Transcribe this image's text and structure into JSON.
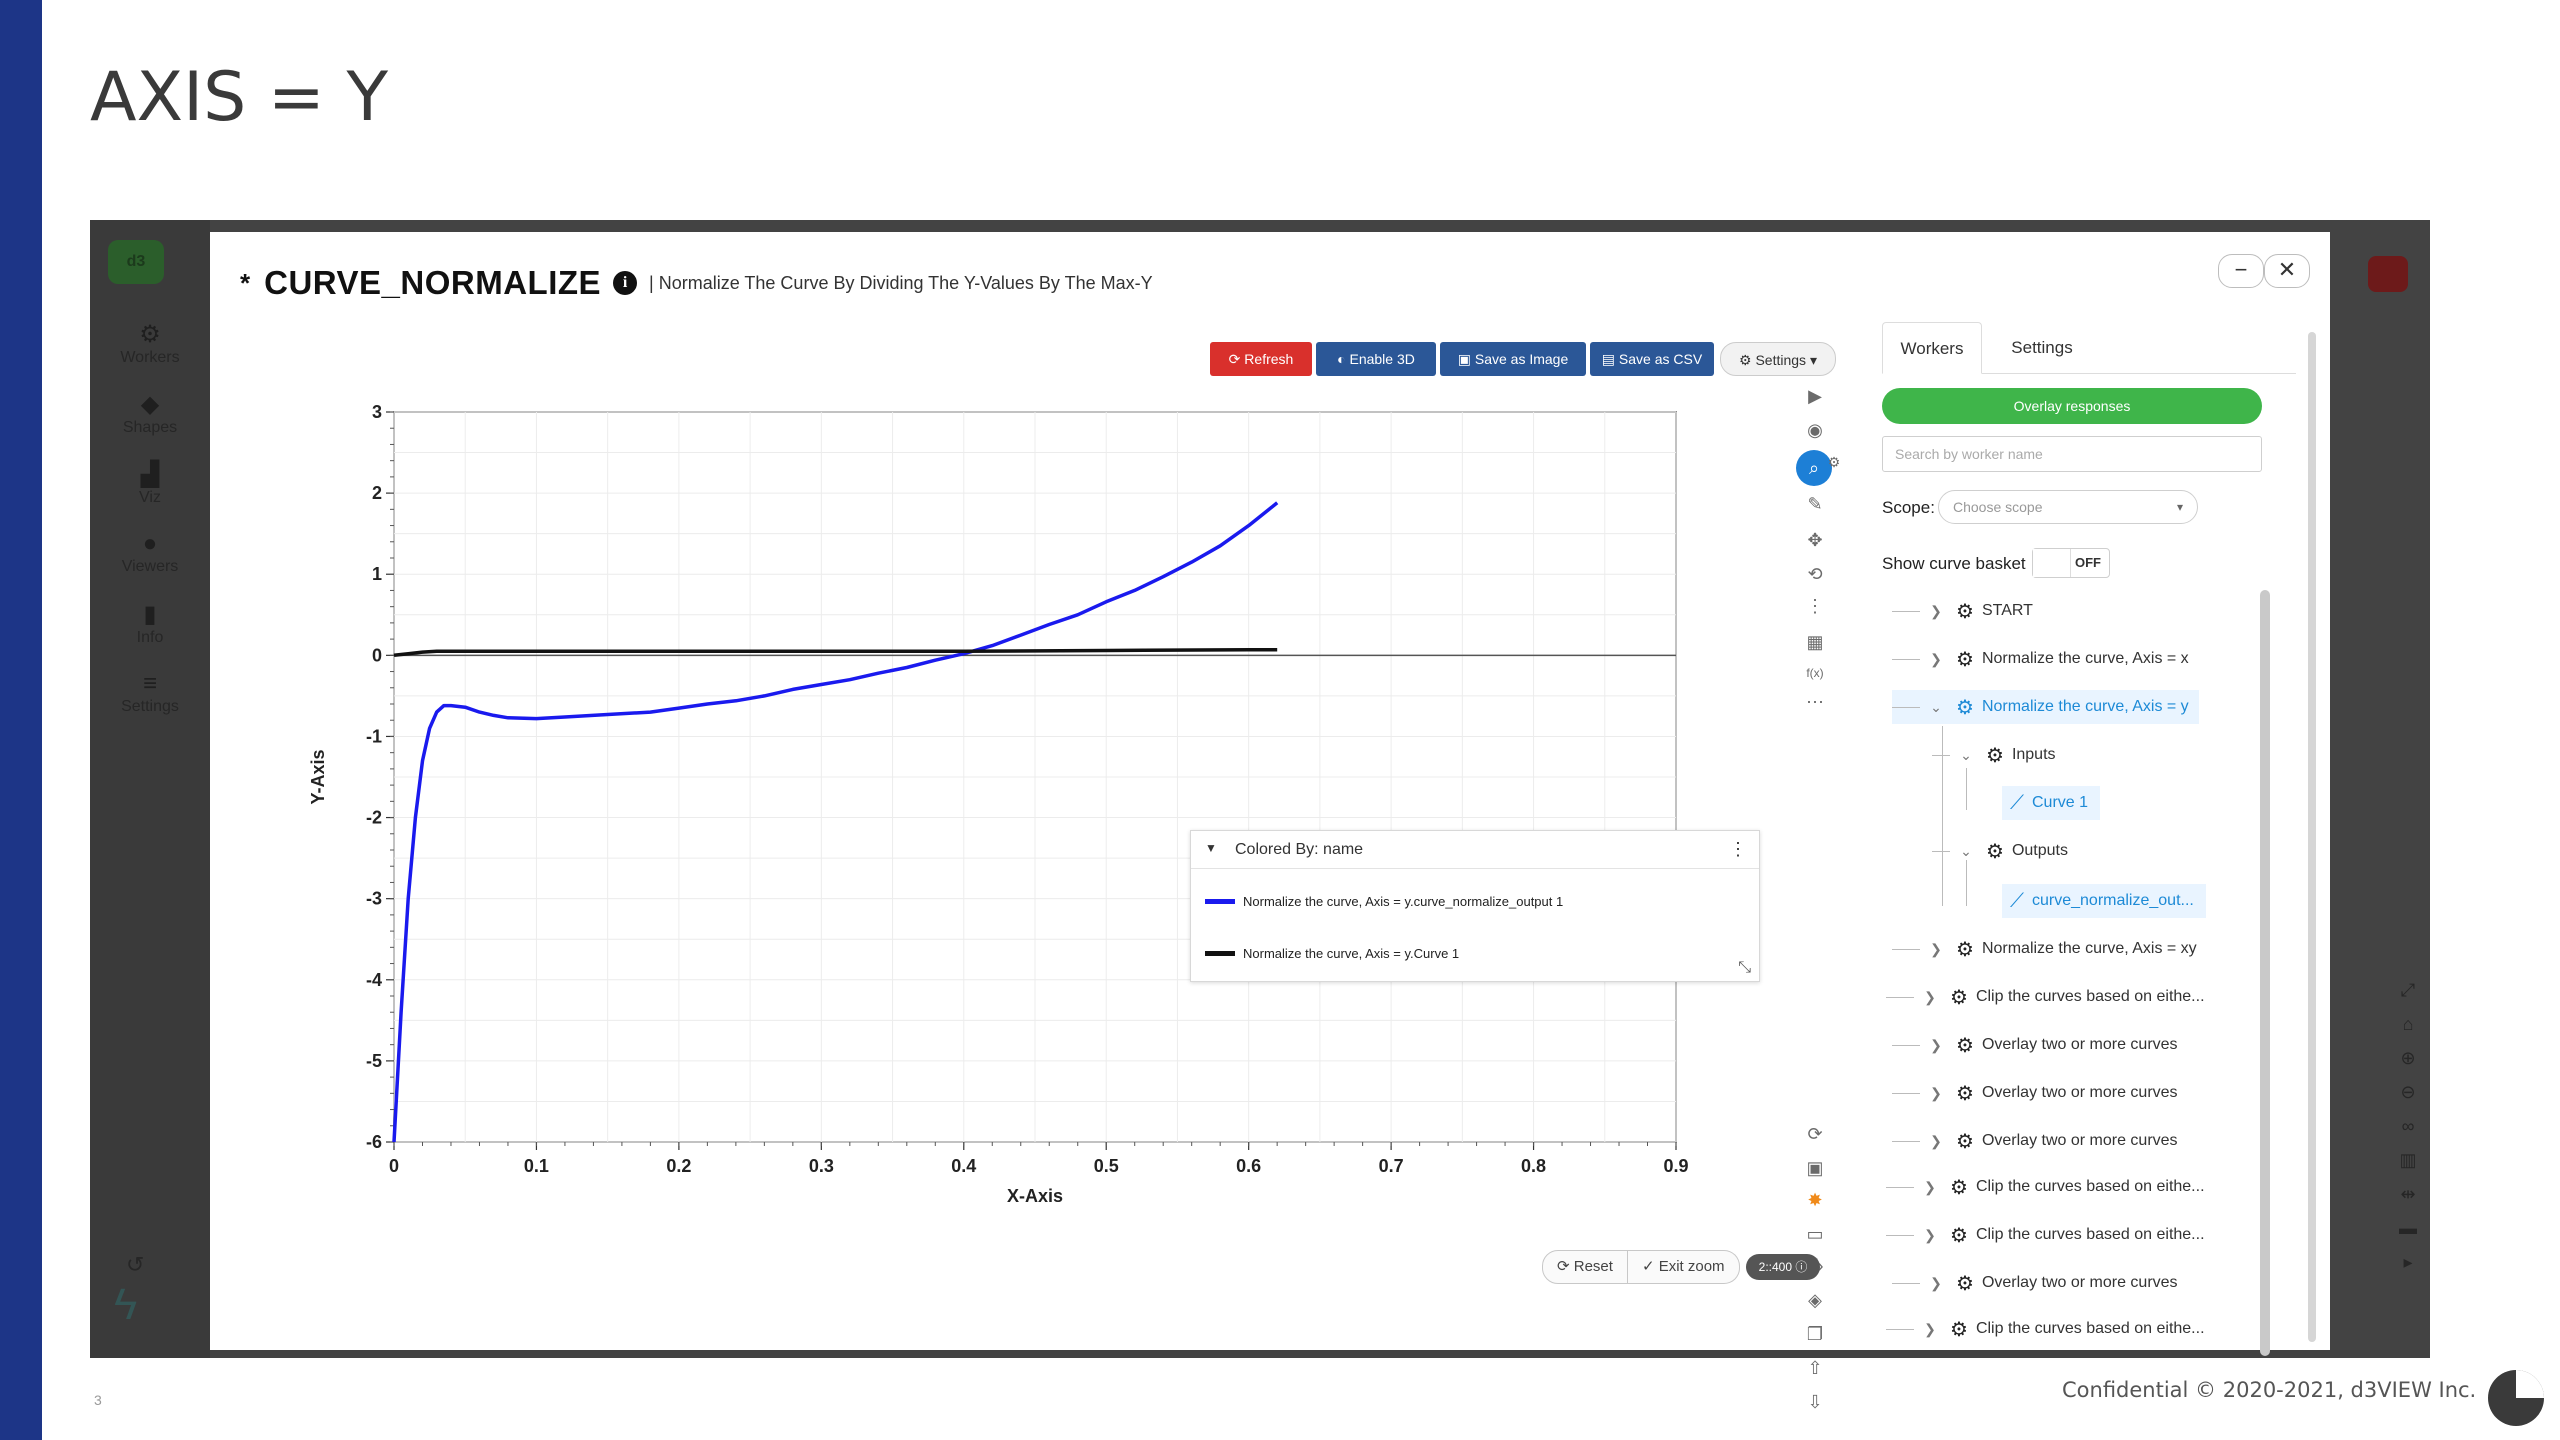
{
  "slide": {
    "title": "AXIS = Y",
    "number": "3",
    "footer": "Confidential © 2020-2021, d3VIEW Inc."
  },
  "background_app": {
    "sidebar": [
      {
        "label": "Workers",
        "icon": "gear-icon"
      },
      {
        "label": "Shapes",
        "icon": "diamond-icon"
      },
      {
        "label": "Viz",
        "icon": "chart-icon"
      },
      {
        "label": "Viewers",
        "icon": "eye-icon"
      },
      {
        "label": "Info",
        "icon": "file-icon"
      },
      {
        "label": "Settings",
        "icon": "sliders-icon"
      }
    ]
  },
  "modal": {
    "star": "*",
    "name": "CURVE_NORMALIZE",
    "description": "| Normalize The Curve By Dividing The Y-Values By The Max-Y",
    "minimize_label": "−",
    "close_label": "✕"
  },
  "toolbar": {
    "refresh": "Refresh",
    "enable3d": "Enable 3D",
    "save_image": "Save as Image",
    "save_csv": "Save as CSV",
    "settings": "Settings"
  },
  "chart_controls": {
    "reset": "Reset",
    "exit_zoom": "Exit zoom",
    "zoom_badge": "2::400"
  },
  "legend": {
    "title": "Colored By: name",
    "items": [
      {
        "label": "Normalize the curve, Axis = y.curve_normalize_output 1",
        "color": "#1a1aee"
      },
      {
        "label": "Normalize the curve, Axis = y.Curve 1",
        "color": "#111111"
      }
    ]
  },
  "chart_data": {
    "type": "line",
    "xlabel": "X-Axis",
    "ylabel": "Y-Axis",
    "xlim": [
      0,
      0.9
    ],
    "ylim": [
      -6,
      3
    ],
    "xticks": [
      "0",
      "0.1",
      "0.2",
      "0.3",
      "0.4",
      "0.5",
      "0.6",
      "0.7",
      "0.8",
      "0.9"
    ],
    "yticks": [
      "3",
      "2",
      "1",
      "0",
      "-1",
      "-2",
      "-3",
      "-4",
      "-5",
      "-6"
    ],
    "grid": true,
    "series": [
      {
        "name": "Normalize the curve, Axis = y.curve_normalize_output 1",
        "color": "#1a1aee",
        "x": [
          0,
          0.005,
          0.01,
          0.015,
          0.02,
          0.025,
          0.03,
          0.035,
          0.04,
          0.05,
          0.06,
          0.07,
          0.08,
          0.1,
          0.12,
          0.15,
          0.18,
          0.2,
          0.22,
          0.24,
          0.26,
          0.28,
          0.3,
          0.32,
          0.34,
          0.36,
          0.38,
          0.4,
          0.42,
          0.44,
          0.46,
          0.48,
          0.5,
          0.52,
          0.54,
          0.56,
          0.58,
          0.6,
          0.62
        ],
        "y": [
          -6,
          -4.4,
          -3.0,
          -2.0,
          -1.3,
          -0.9,
          -0.7,
          -0.62,
          -0.62,
          -0.64,
          -0.7,
          -0.74,
          -0.77,
          -0.78,
          -0.76,
          -0.73,
          -0.7,
          -0.65,
          -0.6,
          -0.56,
          -0.5,
          -0.42,
          -0.36,
          -0.3,
          -0.22,
          -0.15,
          -0.06,
          0.02,
          0.12,
          0.25,
          0.38,
          0.5,
          0.66,
          0.8,
          0.97,
          1.15,
          1.35,
          1.6,
          1.88
        ]
      },
      {
        "name": "Normalize the curve, Axis = y.Curve 1",
        "color": "#111111",
        "x": [
          0,
          0.01,
          0.02,
          0.03,
          0.05,
          0.1,
          0.2,
          0.3,
          0.4,
          0.5,
          0.6,
          0.62
        ],
        "y": [
          0,
          0.02,
          0.04,
          0.05,
          0.05,
          0.05,
          0.05,
          0.05,
          0.05,
          0.06,
          0.07,
          0.07
        ]
      }
    ]
  },
  "right_panel": {
    "tabs": [
      "Workers",
      "Settings"
    ],
    "overlay_button": "Overlay responses",
    "search_placeholder": "Search by worker name",
    "scope_label": "Scope:",
    "scope_placeholder": "Choose scope",
    "basket_label": "Show curve basket",
    "basket_state": "OFF",
    "tree": [
      "START",
      "Normalize the curve, Axis = x",
      "Normalize the curve, Axis = y",
      "Inputs",
      "Curve 1",
      "Outputs",
      "curve_normalize_out...",
      "Normalize the curve, Axis = xy",
      "Clip the curves based on eithe...",
      "Overlay two or more curves",
      "Overlay two or more curves",
      "Overlay two or more curves",
      "Clip the curves based on eithe...",
      "Clip the curves based on eithe...",
      "Overlay two or more curves",
      "Clip the curves based on eithe..."
    ]
  }
}
